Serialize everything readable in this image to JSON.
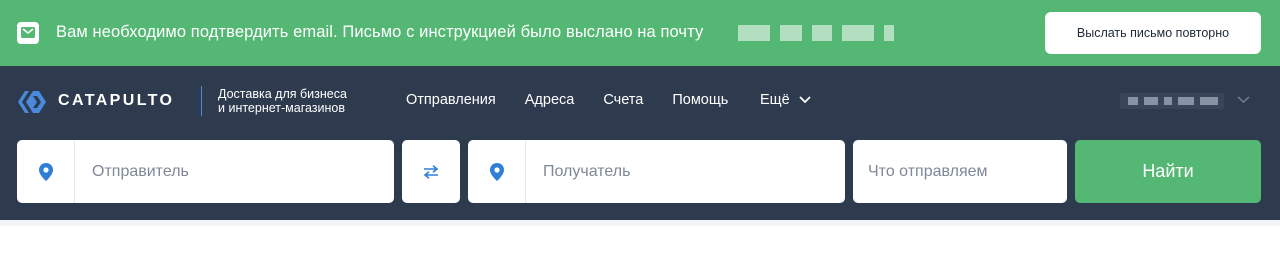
{
  "banner": {
    "message": "Вам необходимо подтвердить email. Письмо с инструкцией было выслано на почту",
    "resend_label": "Выслать письмо повторно",
    "icon": "mail-icon",
    "bg_color": "#54b874"
  },
  "header": {
    "logo_text": "CATAPULTO",
    "tagline_line1": "Доставка для бизнеса",
    "tagline_line2": "и интернет-магазинов",
    "menu": [
      "Отправления",
      "Адреса",
      "Счета",
      "Помощь"
    ],
    "more_label": "Ещё",
    "bg_color": "#2e3a4d"
  },
  "search": {
    "sender_placeholder": "Отправитель",
    "recipient_placeholder": "Получатель",
    "cargo_placeholder": "Что отправляем",
    "find_label": "Найти",
    "accent_color": "#54b874",
    "pin_color": "#2f7fd6"
  }
}
